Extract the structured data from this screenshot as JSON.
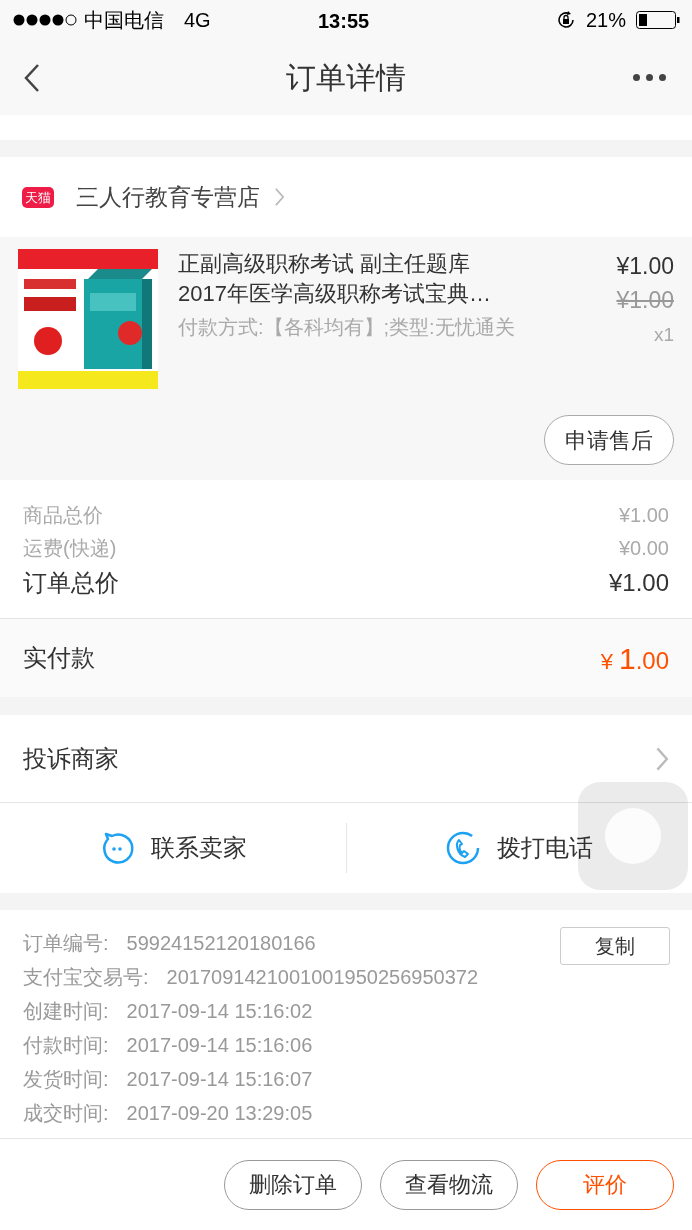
{
  "status_bar": {
    "carrier": "中国电信",
    "network": "4G",
    "time": "13:55",
    "battery": "21%"
  },
  "nav": {
    "title": "订单详情"
  },
  "store": {
    "badge": "天猫",
    "name": "三人行教育专营店"
  },
  "product": {
    "kind": "picture",
    "title": "正副高级职称考试 副主任题库2017年医学高级职称考试宝典…",
    "spec": "付款方式:【各科均有】;类型:无忧通关",
    "price": "¥1.00",
    "original_price": "¥1.00",
    "quantity": "x1",
    "after_sale_button": "申请售后"
  },
  "totals": [
    {
      "label": "商品总价",
      "value": "¥1.00",
      "kind": "minor"
    },
    {
      "label": "运费(快递)",
      "value": "¥0.00",
      "kind": "minor"
    },
    {
      "label": "订单总价",
      "value": "¥1.00",
      "kind": "major"
    }
  ],
  "paid": {
    "label": "实付款",
    "currency": "¥",
    "integer": "1",
    "decimals": ".00"
  },
  "complaint": {
    "label": "投诉商家"
  },
  "contact": [
    {
      "label": "联系卖家",
      "kind": "chat"
    },
    {
      "label": "拨打电话",
      "kind": "phone"
    }
  ],
  "info": {
    "copy_button": "复制",
    "rows": [
      {
        "label": "订单编号:",
        "value": "59924152120180166"
      },
      {
        "label": "支付宝交易号:",
        "value": "2017091421001001950256950372"
      },
      {
        "label": "创建时间:",
        "value": "2017-09-14 15:16:02"
      },
      {
        "label": "付款时间:",
        "value": "2017-09-14 15:16:06"
      },
      {
        "label": "发货时间:",
        "value": "2017-09-14 15:16:07"
      },
      {
        "label": "成交时间:",
        "value": "2017-09-20 13:29:05"
      }
    ]
  },
  "actions": [
    {
      "label": "删除订单",
      "kind": "plain"
    },
    {
      "label": "查看物流",
      "kind": "plain"
    },
    {
      "label": "评价",
      "kind": "primary"
    }
  ]
}
